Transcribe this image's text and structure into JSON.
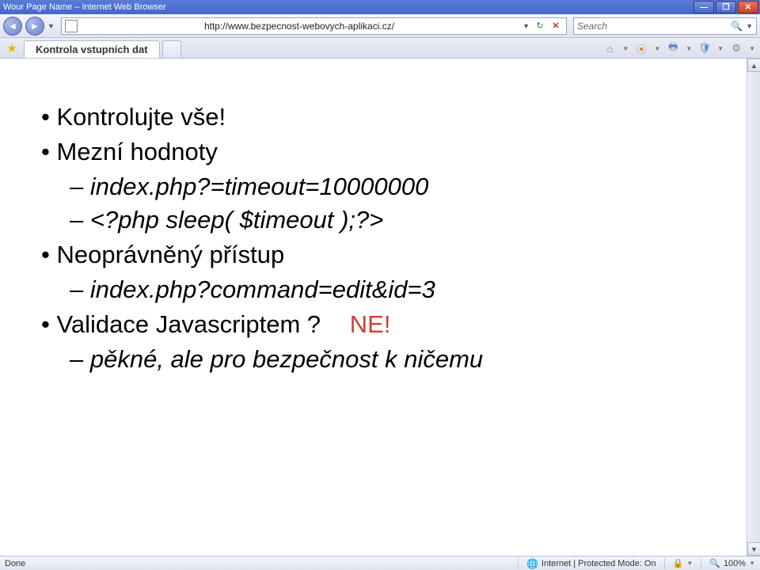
{
  "titlebar": {
    "text": "Wour Page Name – Internet Web Browser"
  },
  "nav": {
    "url": "http://www.bezpecnost-webovych-aplikaci.cz/",
    "search_placeholder": "Search"
  },
  "tab": {
    "label": "Kontrola vstupních dat"
  },
  "content": {
    "items": [
      "Kontrolujte vše!",
      "Mezní hodnoty",
      "Neoprávněný přístup",
      "Validace Javascriptem ?"
    ],
    "subs_mezni": [
      "index.php?=timeout=10000000",
      "<?php sleep( $timeout );?>"
    ],
    "subs_neop": [
      "index.php?command=edit&id=3"
    ],
    "subs_valid": [
      "pěkné, ale pro bezpečnost k ničemu"
    ],
    "answer": "NE!"
  },
  "status": {
    "done": "Done",
    "zone": "Internet | Protected Mode: On",
    "zoom": "100%"
  }
}
